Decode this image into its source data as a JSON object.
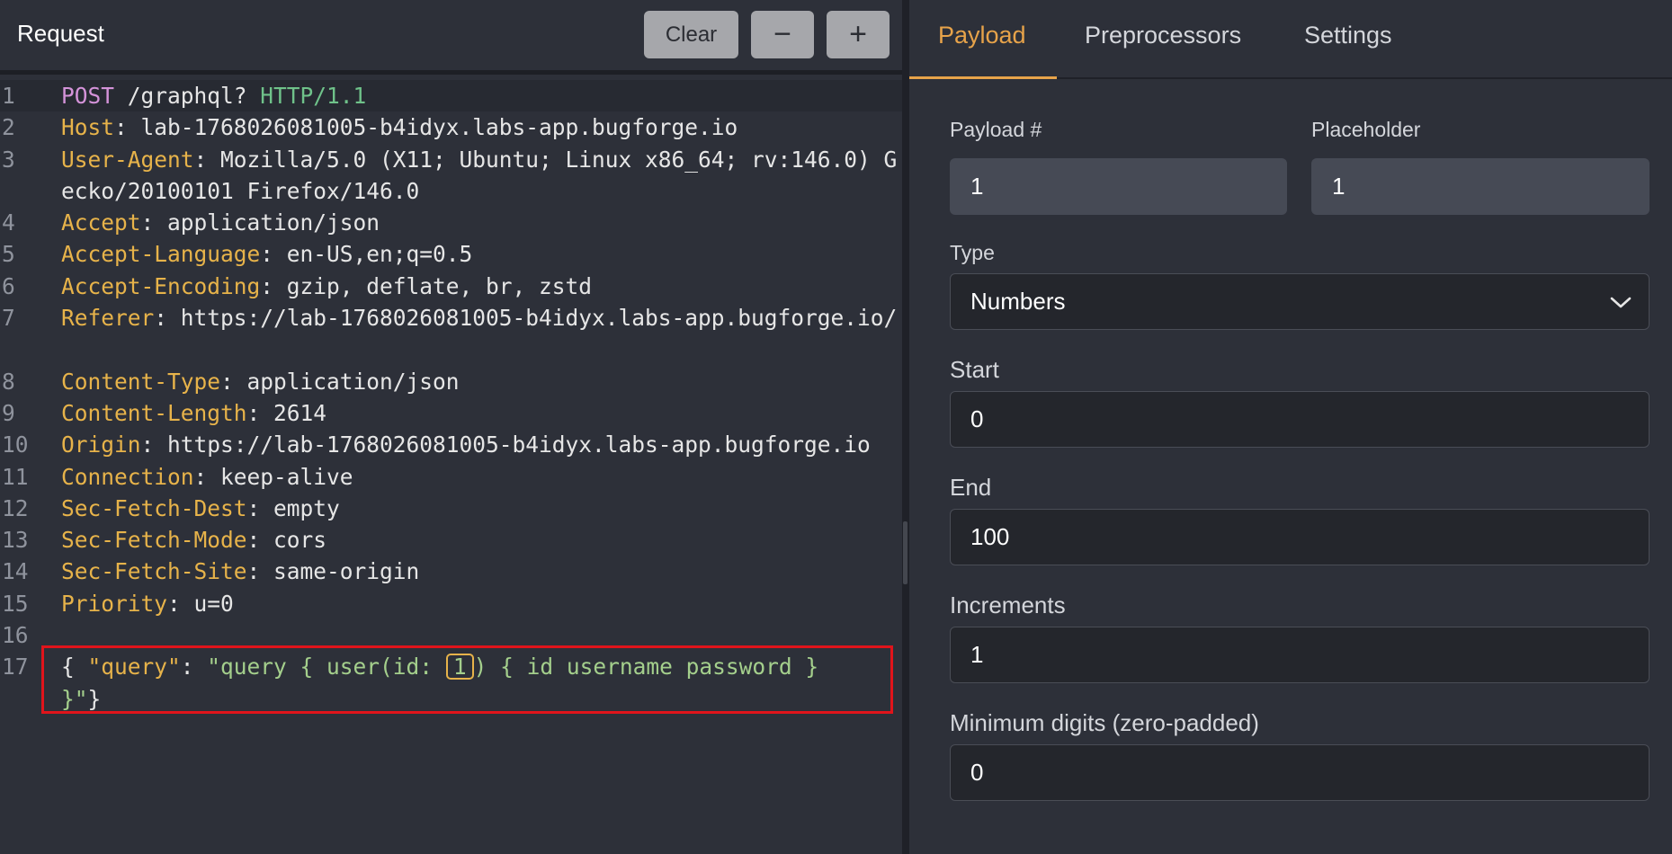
{
  "request_panel": {
    "title": "Request",
    "clear_label": "Clear",
    "minus_label": "−",
    "plus_label": "+"
  },
  "editor": {
    "lines": [
      {
        "n": "1",
        "method": "POST",
        "path": " /graphql? ",
        "proto": "HTTP/1.1"
      },
      {
        "n": "2",
        "name": "Host",
        "value": ": lab-1768026081005-b4idyx.labs-app.bugforge.io"
      },
      {
        "n": "3",
        "name": "User-Agent",
        "value": ": Mozilla/5.0 (X11; Ubuntu; Linux x86_64; rv:146.0) Gecko/20100101 Firefox/146.0"
      },
      {
        "n": "4",
        "name": "Accept",
        "value": ": application/json"
      },
      {
        "n": "5",
        "name": "Accept-Language",
        "value": ": en-US,en;q=0.5"
      },
      {
        "n": "6",
        "name": "Accept-Encoding",
        "value": ": gzip, deflate, br, zstd"
      },
      {
        "n": "7",
        "name": "Referer",
        "value": ": https://lab-1768026081005-b4idyx.labs-app.bugforge.io/"
      },
      {
        "n": "8",
        "name": "Content-Type",
        "value": ": application/json"
      },
      {
        "n": "9",
        "name": "Content-Length",
        "value": ": 2614"
      },
      {
        "n": "10",
        "name": "Origin",
        "value": ": https://lab-1768026081005-b4idyx.labs-app.bugforge.io"
      },
      {
        "n": "11",
        "name": "Connection",
        "value": ": keep-alive"
      },
      {
        "n": "12",
        "name": "Sec-Fetch-Dest",
        "value": ": empty"
      },
      {
        "n": "13",
        "name": "Sec-Fetch-Mode",
        "value": ": cors"
      },
      {
        "n": "14",
        "name": "Sec-Fetch-Site",
        "value": ": same-origin"
      },
      {
        "n": "15",
        "name": "Priority",
        "value": ": u=0"
      },
      {
        "n": "16"
      },
      {
        "n": "17",
        "body_open": "{ ",
        "body_key": "\"query\"",
        "body_colon": ": ",
        "body_val_a": "\"query { user(id: ",
        "body_marker": "1",
        "body_val_b": ") { id username password }",
        "body_val_c": "}\"",
        "body_close": "}"
      }
    ]
  },
  "tabs": {
    "payload": "Payload",
    "preprocessors": "Preprocessors",
    "settings": "Settings"
  },
  "form": {
    "payload_num_label": "Payload #",
    "payload_num_value": "1",
    "placeholder_label": "Placeholder",
    "placeholder_value": "1",
    "type_label": "Type",
    "type_value": "Numbers",
    "start_label": "Start",
    "start_value": "0",
    "end_label": "End",
    "end_value": "100",
    "increments_label": "Increments",
    "increments_value": "1",
    "min_digits_label": "Minimum digits (zero-padded)",
    "min_digits_value": "0"
  },
  "colors": {
    "accent": "#e7a34a",
    "header_name": "#e7b34a",
    "method": "#d493d9",
    "protocol": "#6fc28a",
    "highlight_border": "#e0141b"
  }
}
